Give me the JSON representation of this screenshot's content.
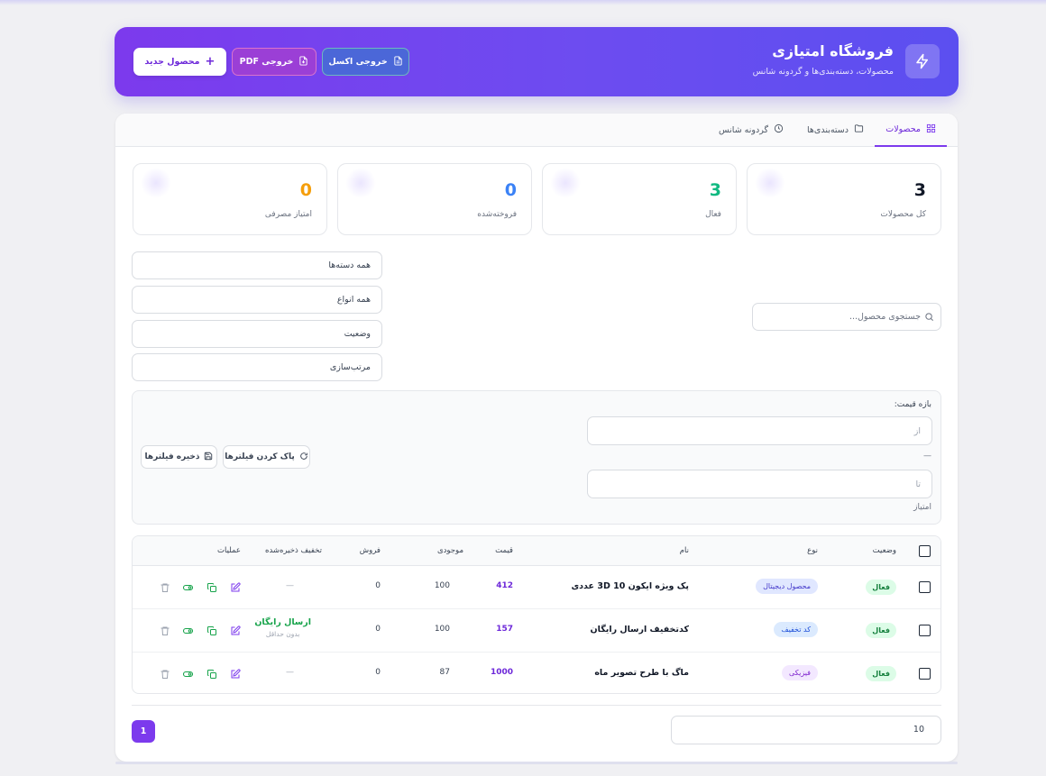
{
  "header": {
    "title": "فروشگاه امتیازی",
    "subtitle": "محصولات، دسته‌بندی‌ها و گردونه شانس",
    "btn_excel": "خروجی اکسل",
    "btn_pdf": "خروجی PDF",
    "btn_new": "محصول جدید"
  },
  "tabs": [
    {
      "label": "محصولات",
      "active": true
    },
    {
      "label": "دسته‌بندی‌ها"
    },
    {
      "label": "گردونه شانس"
    }
  ],
  "stats": [
    {
      "value": "3",
      "label": "کل محصولات",
      "color": "#111827"
    },
    {
      "value": "3",
      "label": "فعال",
      "color": "#10b981"
    },
    {
      "value": "0",
      "label": "فروخته‌شده",
      "color": "#3b82f6"
    },
    {
      "value": "0",
      "label": "امتیاز مصرفی",
      "color": "#f59e0b"
    }
  ],
  "filters": {
    "search_placeholder": "جستجوی محصول...",
    "category": "همه دسته‌ها",
    "type": "همه انواع",
    "status": "وضعیت",
    "sort": "مرتب‌سازی"
  },
  "price_range": {
    "label": "بازه قیمت:",
    "from_placeholder": "از",
    "dash": "—",
    "to_placeholder": "تا",
    "unit": "امتیاز",
    "clear_label": "پاک کردن فیلترها",
    "save_label": "ذخیره فیلترها"
  },
  "table": {
    "columns": {
      "status": "وضعیت",
      "type": "نوع",
      "name": "نام",
      "price": "قیمت",
      "stock": "موجودی",
      "sales": "فروش",
      "discount": "تخفیف ذخیره‌شده",
      "actions": "عملیات"
    },
    "rows": [
      {
        "status": "فعال",
        "type": "محصول دیجیتال",
        "type_bg": "#e0e7ff",
        "type_fg": "#4338ca",
        "name": "پک ویژه ایکون 10 3D عددی",
        "price": "412",
        "stock": "100",
        "sales": "0",
        "discount": "—",
        "discount_sub": ""
      },
      {
        "status": "فعال",
        "type": "کد تخفیف",
        "type_bg": "#dbeafe",
        "type_fg": "#1d4ed8",
        "name": "کدتخفیف ارسال رایگان",
        "price": "157",
        "stock": "100",
        "sales": "0",
        "discount": "ارسال رایگان",
        "discount_sub": "بدون حداقل"
      },
      {
        "status": "فعال",
        "type": "فیزیکی",
        "type_bg": "#f3e8ff",
        "type_fg": "#7e22ce",
        "name": "ماگ با طرح تصویر ماه",
        "price": "1000",
        "stock": "87",
        "sales": "0",
        "discount": "—",
        "discount_sub": ""
      }
    ]
  },
  "pagination": {
    "per_page": "10",
    "current_page": "1"
  }
}
